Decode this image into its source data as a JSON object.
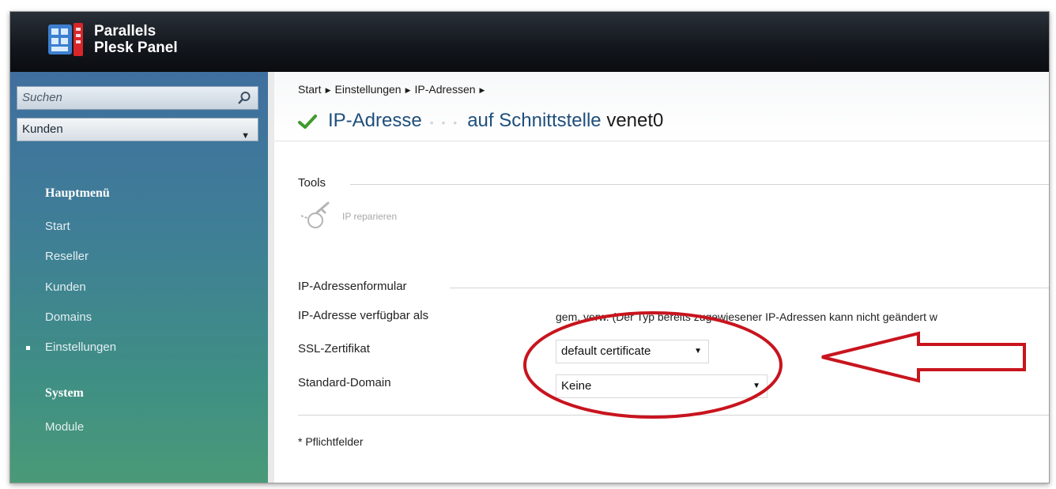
{
  "app": {
    "brand_line1": "Parallels",
    "brand_line2": "Plesk Panel"
  },
  "sidebar": {
    "search_placeholder": "Suchen",
    "select_value": "Kunden",
    "main_menu_heading": "Hauptmenü",
    "main_items": [
      {
        "label": "Start"
      },
      {
        "label": "Reseller"
      },
      {
        "label": "Kunden"
      },
      {
        "label": "Domains"
      },
      {
        "label": "Einstellungen",
        "active": true
      }
    ],
    "system_heading": "System",
    "system_items": [
      {
        "label": "Module"
      }
    ]
  },
  "header": {
    "breadcrumb": [
      "Start",
      "Einstellungen",
      "IP-Adressen"
    ],
    "title_prefix": "IP-Adresse",
    "title_ip_obscured": "•  •  •",
    "title_mid": "auf Schnittstelle",
    "title_iface": "venet0"
  },
  "tools": {
    "section_label": "Tools",
    "repair_label": "IP reparieren"
  },
  "form": {
    "section_label": "IP-Adressenformular",
    "fields": [
      {
        "label": "IP-Adresse verfügbar als",
        "value": "gem. verw. (Der Typ bereits zugewiesener IP-Adressen kann nicht geändert w"
      },
      {
        "label": "SSL-Zertifikat",
        "value": "default certificate"
      },
      {
        "label": "Standard-Domain",
        "value": "Keine"
      }
    ],
    "required_note": "* Pflichtfelder"
  },
  "annotation": {
    "color": "#c8141e"
  },
  "colors": {
    "title_blue": "#1f4f7c",
    "check_green": "#3e9a2c"
  }
}
